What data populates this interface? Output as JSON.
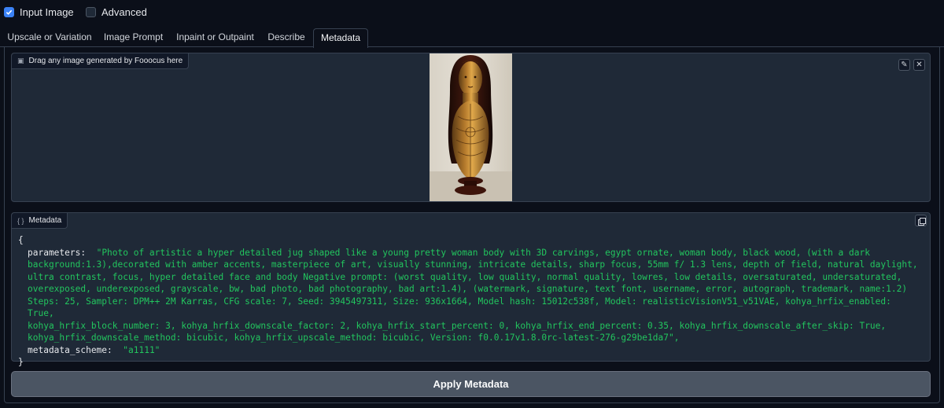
{
  "checkboxes": {
    "input_image": {
      "label": "Input Image",
      "checked": true
    },
    "advanced": {
      "label": "Advanced",
      "checked": false
    }
  },
  "tabs": [
    {
      "label": "Upscale or Variation",
      "active": false
    },
    {
      "label": "Image Prompt",
      "active": false
    },
    {
      "label": "Inpaint or Outpaint",
      "active": false
    },
    {
      "label": "Describe",
      "active": false
    },
    {
      "label": "Metadata",
      "active": true
    }
  ],
  "image_input": {
    "label": "Drag any image generated by Fooocus here",
    "edit_icon": "pencil-icon",
    "clear_icon": "close-icon"
  },
  "metadata": {
    "label": "Metadata",
    "copy_icon": "copy-icon",
    "open_brace": "{",
    "close_brace": "}",
    "parameters_key": "parameters:",
    "parameters_value": "\"Photo of artistic a hyper detailed jug shaped like a young pretty woman body with 3D carvings, egypt ornate, woman body, black wood, (with a dark background:1.3),decorated with amber accents, masterpiece of art, visually stunning, intricate details, sharp focus, 55mm f/ 1.3 lens, depth of field, natural daylight, ultra contrast, focus, hyper detailed face and body Negative prompt: (worst quality, low quality, normal quality, lowres, low details, oversaturated, undersaturated, overexposed, underexposed, grayscale, bw, bad photo, bad photography, bad art:1.4), (watermark, signature, text font, username, error, autograph, trademark, name:1.2) Steps: 25, Sampler: DPM++ 2M Karras, CFG scale: 7, Seed: 3945497311, Size: 936x1664, Model hash: 15012c538f, Model: realisticVisionV51_v51VAE, kohya_hrfix_enabled: True, kohya_hrfix_block_number: 3, kohya_hrfix_downscale_factor: 2, kohya_hrfix_start_percent: 0, kohya_hrfix_end_percent: 0.35, kohya_hrfix_downscale_after_skip: True, kohya_hrfix_downscale_method: bicubic, kohya_hrfix_upscale_method: bicubic, Version: f0.0.17v1.8.0rc-latest-276-g29be1da7\"",
    "parameters_lines": [
      "\"Photo of artistic a hyper detailed jug shaped like a young pretty woman body with 3D carvings, egypt ornate, woman body, black wood, (with a dark",
      "background:1.3),decorated with amber accents, masterpiece of art, visually stunning, intricate details, sharp focus, 55mm f/ 1.3 lens, depth of field, natural daylight,",
      "ultra contrast, focus, hyper detailed face and body Negative prompt: (worst quality, low quality, normal quality, lowres, low details, oversaturated, undersaturated,",
      "overexposed, underexposed, grayscale, bw, bad photo, bad photography, bad art:1.4), (watermark, signature, text font, username, error, autograph, trademark, name:1.2)",
      "Steps: 25, Sampler: DPM++ 2M Karras, CFG scale: 7, Seed: 3945497311, Size: 936x1664, Model hash: 15012c538f, Model: realisticVisionV51_v51VAE, kohya_hrfix_enabled: True,",
      "kohya_hrfix_block_number: 3, kohya_hrfix_downscale_factor: 2, kohya_hrfix_start_percent: 0, kohya_hrfix_end_percent: 0.35, kohya_hrfix_downscale_after_skip: True,",
      "kohya_hrfix_downscale_method: bicubic, kohya_hrfix_upscale_method: bicubic, Version: f0.0.17v1.8.0rc-latest-276-g29be1da7\","
    ],
    "scheme_key": "metadata_scheme:",
    "scheme_value": "\"a1111\""
  },
  "apply_button": {
    "label": "Apply Metadata"
  },
  "colors": {
    "background": "#0b0f19",
    "panel": "#1f2937",
    "accent": "#3b82f6",
    "string": "#22c55e",
    "button": "#4b5563"
  }
}
